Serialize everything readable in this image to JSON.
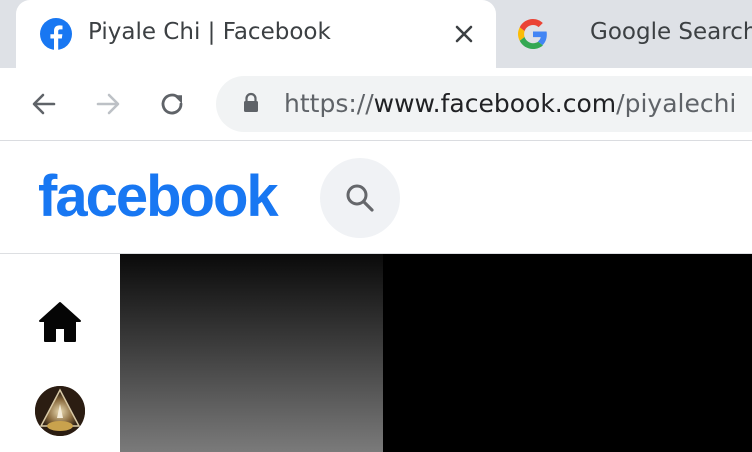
{
  "browser": {
    "tabs": [
      {
        "title": "Piyale Chi | Facebook",
        "favicon": "facebook-favicon",
        "active": true
      },
      {
        "title": "Google Search -",
        "favicon": "google-favicon",
        "active": false
      }
    ],
    "close_icon": "close-icon",
    "nav": {
      "back": "back-arrow-icon",
      "forward": "forward-arrow-icon",
      "reload": "reload-icon"
    },
    "address": {
      "scheme": "https://",
      "host": "www.facebook.com",
      "path": "/piyalechi",
      "lock_icon": "lock-icon"
    }
  },
  "facebook": {
    "logo": "facebook",
    "search_icon": "search-icon",
    "left_nav": [
      {
        "icon": "home-icon"
      },
      {
        "icon": "avatar"
      }
    ]
  },
  "colors": {
    "facebook_blue": "#1877f2",
    "tabstrip": "#dee1e6",
    "omnibox": "#f1f3f4",
    "search_bg": "#f0f2f5"
  }
}
